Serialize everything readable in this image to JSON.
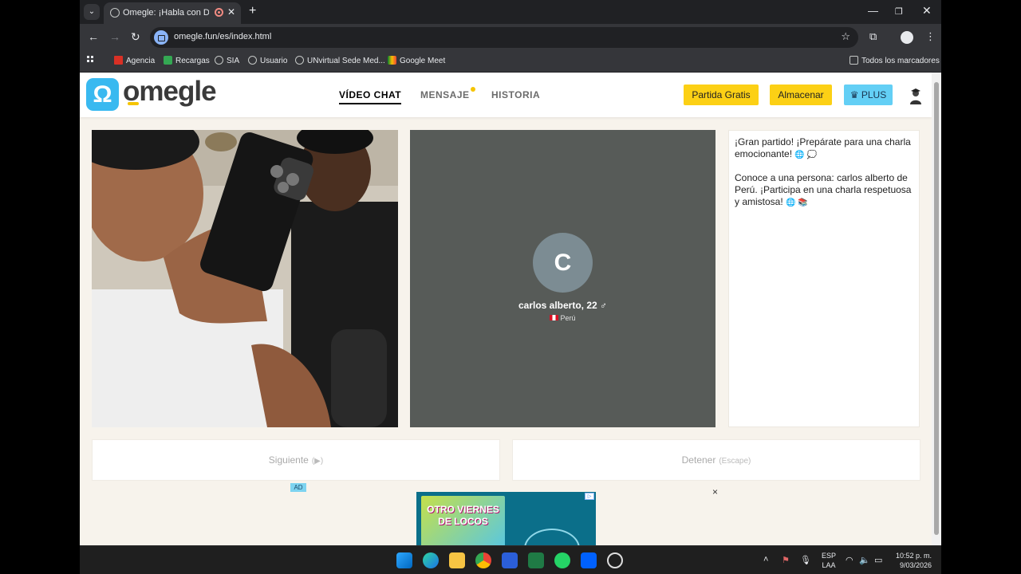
{
  "browser": {
    "tab_title": "Omegle: ¡Habla con Descono",
    "url": "omegle.fun/es/index.html",
    "bookmarks": [
      "Agencia",
      "Recargas",
      "SIA",
      "Usuario",
      "UNvirtual Sede Med...",
      "Google Meet"
    ],
    "all_bookmarks": "Todos los marcadores"
  },
  "site": {
    "logo_text": "omegle",
    "nav": [
      {
        "label": "VÍDEO CHAT",
        "active": true
      },
      {
        "label": "MENSAJE",
        "active": false
      },
      {
        "label": "HISTORIA",
        "active": false
      }
    ],
    "buttons": {
      "free_match": "Partida Gratis",
      "store": "Almacenar",
      "plus": "PLUS"
    }
  },
  "remote_user": {
    "initial": "C",
    "name": "carlos alberto, 22 ♂",
    "country": "Perú"
  },
  "chat": {
    "message1": "¡Gran partido! ¡Prepárate para una charla emocionante!",
    "message2": "Conoce a una persona: carlos alberto de Perú. ¡Participa en una charla respetuosa y amistosa!"
  },
  "controls": {
    "next_label": "Siguiente",
    "next_hint": "(▶)",
    "stop_label": "Detener",
    "stop_hint": "(Escape)"
  },
  "ad": {
    "label": "AD",
    "close": "×",
    "poster_line1": "OTRO VIERNES",
    "poster_line2": "DE LOCOS"
  },
  "taskbar": {
    "lang1": "ESP",
    "lang2": "LAA",
    "time": "10:52 p. m.",
    "date": "9/03/2026"
  },
  "colors": {
    "accent_yellow": "#fcd015",
    "plus_blue": "#63cff5",
    "logo_blue": "#39b9f0",
    "page_bg": "#f7f3ec"
  }
}
